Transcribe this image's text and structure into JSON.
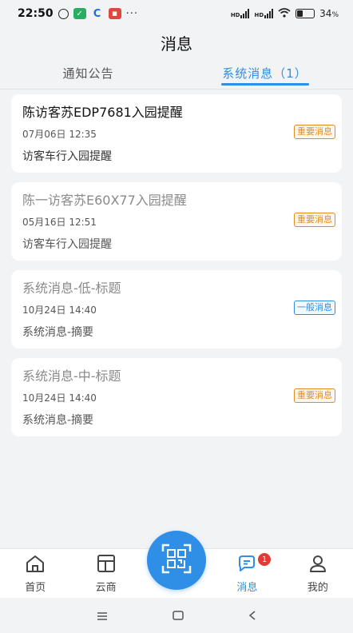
{
  "status_bar": {
    "time": "22:50",
    "more": "···",
    "network_1": "HD",
    "network_2": "HD",
    "battery": "34",
    "battery_unit": "%",
    "battery_level": 0.34
  },
  "header": {
    "title": "消息"
  },
  "tabs": [
    {
      "label": "通知公告",
      "active": false
    },
    {
      "label": "系统消息（1）",
      "active": true
    }
  ],
  "messages": [
    {
      "title": "陈访客苏EDP7681入园提醒",
      "time": "07月06日 12:35",
      "summary": "访客车行入园提醒",
      "badge": "重要消息",
      "badge_color": "#e58a1f",
      "read": false
    },
    {
      "title": "陈一访客苏E60X77入园提醒",
      "time": "05月16日 12:51",
      "summary": "访客车行入园提醒",
      "badge": "重要消息",
      "badge_color": "#e58a1f",
      "read": true
    },
    {
      "title": "系统消息-低-标题",
      "time": "10月24日 14:40",
      "summary": "系统消息-摘要",
      "badge": "一般消息",
      "badge_color": "#2f8ee5",
      "read": true
    },
    {
      "title": "系统消息-中-标题",
      "time": "10月24日 14:40",
      "summary": "系统消息-摘要",
      "badge": "重要消息",
      "badge_color": "#e58a1f",
      "read": true
    }
  ],
  "tabbar": {
    "home": "首页",
    "cloud": "云商",
    "messages": "消息",
    "messages_count": "1",
    "mine": "我的"
  },
  "colors": {
    "accent": "#2f8ee5",
    "important": "#e58a1f",
    "badge_red": "#e53935"
  }
}
